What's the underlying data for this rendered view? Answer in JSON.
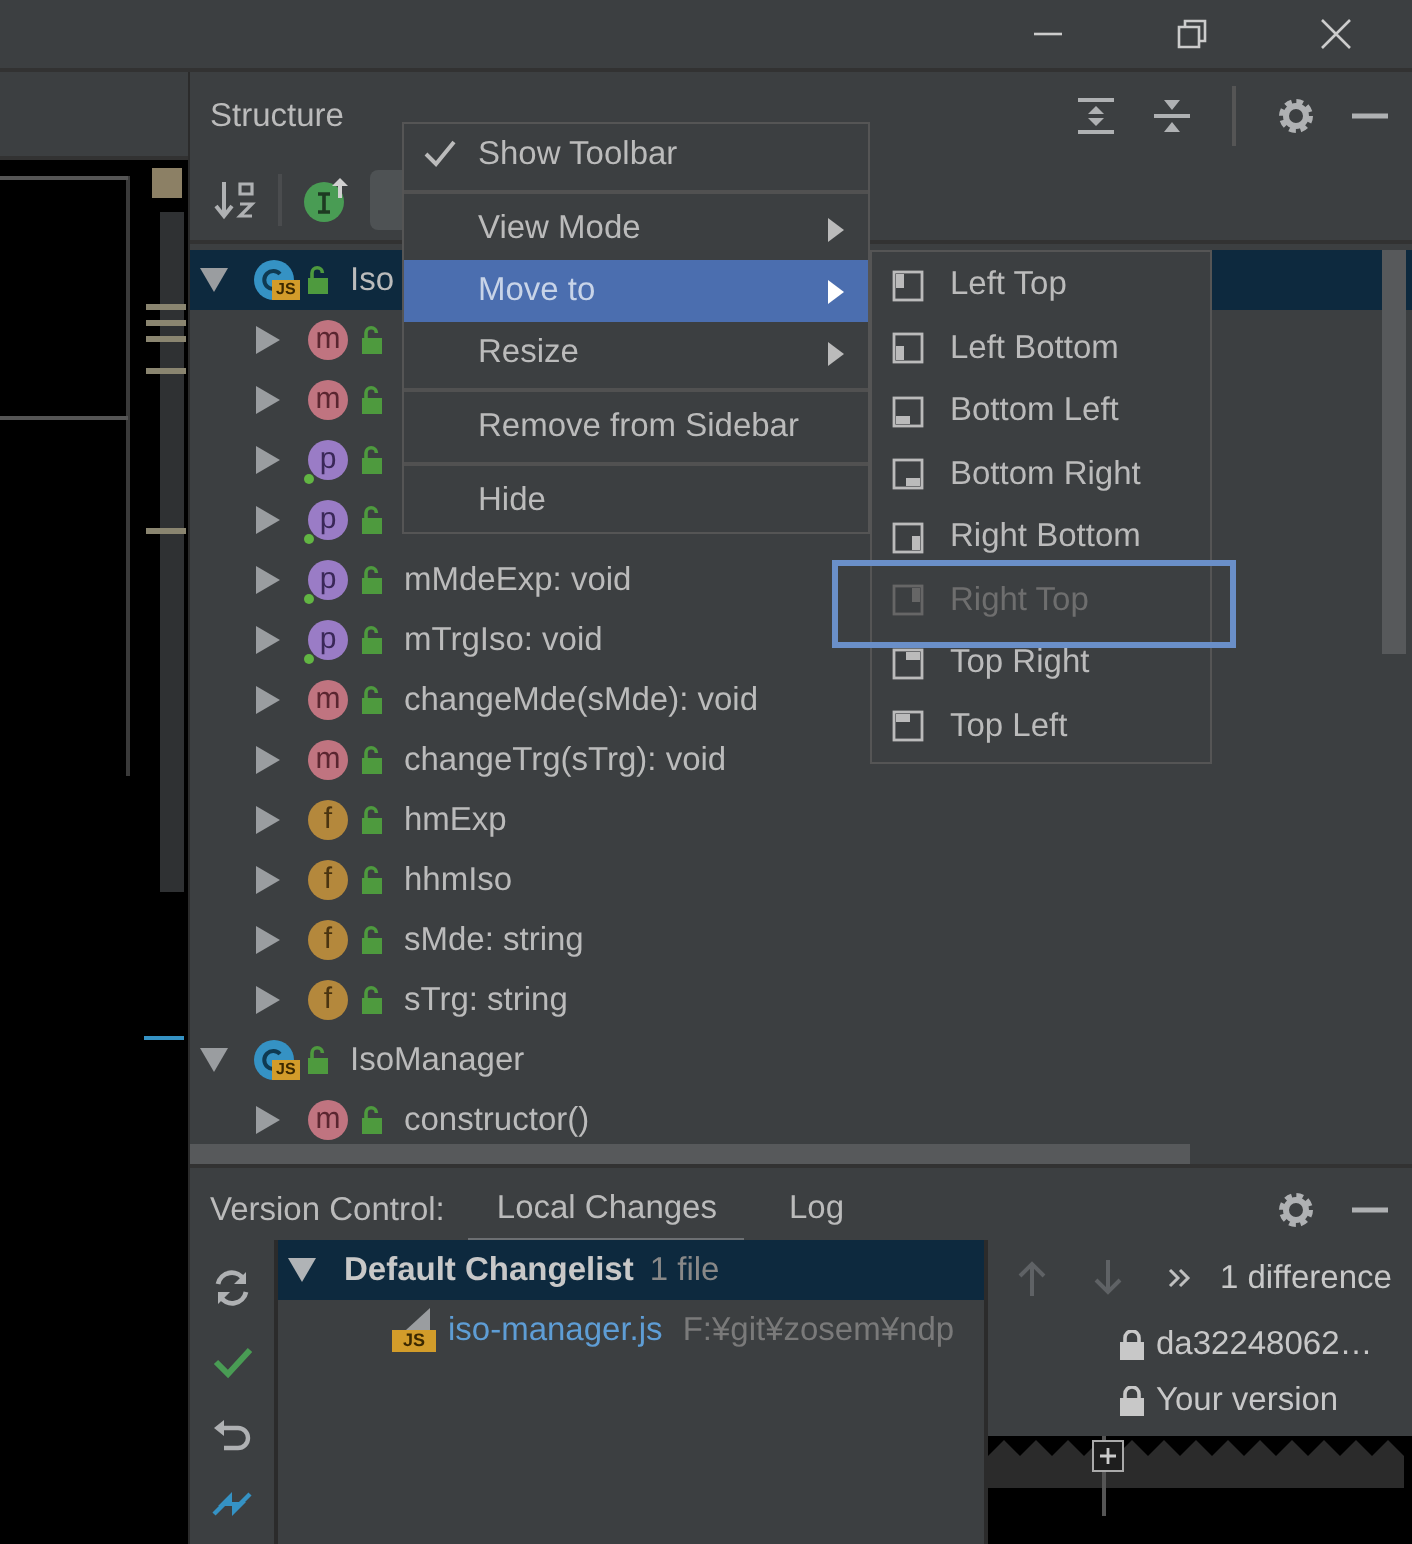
{
  "structure": {
    "title": "Structure",
    "tree": [
      {
        "file_badge": "JS",
        "kind": "class",
        "label": "Iso",
        "expanded": true,
        "selected": true,
        "children": [
          {
            "badge": "m",
            "kind": "method",
            "expanded": false,
            "selected": false
          },
          {
            "badge": "m",
            "kind": "method",
            "expanded": false,
            "selected": false
          },
          {
            "badge": "p",
            "kind": "property",
            "expanded": false,
            "selected": false
          },
          {
            "badge": "p",
            "kind": "property",
            "expanded": false,
            "selected": false
          },
          {
            "badge": "p",
            "kind": "property",
            "label": "mMdeExp: void",
            "expanded": false,
            "selected": false
          },
          {
            "badge": "p",
            "kind": "property",
            "label": "mTrgIso: void",
            "expanded": false,
            "selected": false
          },
          {
            "badge": "m",
            "kind": "method",
            "label": "changeMde(sMde): void",
            "expanded": false,
            "selected": false
          },
          {
            "badge": "m",
            "kind": "method",
            "label": "changeTrg(sTrg): void",
            "expanded": false,
            "selected": false
          },
          {
            "badge": "f",
            "kind": "field",
            "label": "hmExp",
            "expanded": false,
            "selected": false
          },
          {
            "badge": "f",
            "kind": "field",
            "label": "hhmIso",
            "expanded": false,
            "selected": false
          },
          {
            "badge": "f",
            "kind": "field",
            "label": "sMde: string",
            "expanded": false,
            "selected": false
          },
          {
            "badge": "f",
            "kind": "field",
            "label": "sTrg: string",
            "expanded": false,
            "selected": false
          }
        ]
      },
      {
        "file_badge": "JS",
        "kind": "class",
        "label": "IsoManager",
        "expanded": true,
        "selected": false,
        "children": [
          {
            "badge": "m",
            "kind": "method",
            "label": "constructor()",
            "expanded": false,
            "selected": false
          }
        ]
      }
    ]
  },
  "context_menu": {
    "groups": [
      [
        {
          "label": "Show Toolbar",
          "checked": true,
          "submenu": false,
          "selected": false
        }
      ],
      [
        {
          "label": "View Mode",
          "checked": false,
          "submenu": true,
          "selected": false
        },
        {
          "label": "Move to",
          "checked": false,
          "submenu": true,
          "selected": true
        },
        {
          "label": "Resize",
          "checked": false,
          "submenu": true,
          "selected": false
        }
      ],
      [
        {
          "label": "Remove from Sidebar",
          "checked": false,
          "submenu": false,
          "selected": false
        }
      ],
      [
        {
          "label": "Hide",
          "checked": false,
          "submenu": false,
          "selected": false
        }
      ]
    ]
  },
  "submenu": {
    "items": [
      {
        "label": "Left Top",
        "kind": "left-top",
        "disabled": false
      },
      {
        "label": "Left Bottom",
        "kind": "left-bottom",
        "disabled": false
      },
      {
        "label": "Bottom Left",
        "kind": "bottom-left",
        "disabled": false
      },
      {
        "label": "Bottom Right",
        "kind": "bottom-right",
        "disabled": false
      },
      {
        "label": "Right Bottom",
        "kind": "right-bottom",
        "disabled": false
      },
      {
        "label": "Right Top",
        "kind": "right-top",
        "disabled": true
      },
      {
        "label": "Top Right",
        "kind": "top-right",
        "disabled": false
      },
      {
        "label": "Top Left",
        "kind": "top-left",
        "disabled": false
      }
    ]
  },
  "version_control": {
    "label": "Version Control:",
    "tabs": [
      {
        "label": "Local Changes",
        "selected": true
      },
      {
        "label": "Log",
        "selected": false
      }
    ],
    "changelist": {
      "name": "Default Changelist",
      "count": "1 file",
      "expanded": true,
      "selected": true,
      "files": [
        {
          "name": "iso-manager.js",
          "badge": "JS",
          "path": "F:¥git¥zosem¥ndp"
        }
      ]
    },
    "diff": {
      "summary": "1 difference",
      "left_version": "da32248062…",
      "right_version": "Your version"
    }
  }
}
